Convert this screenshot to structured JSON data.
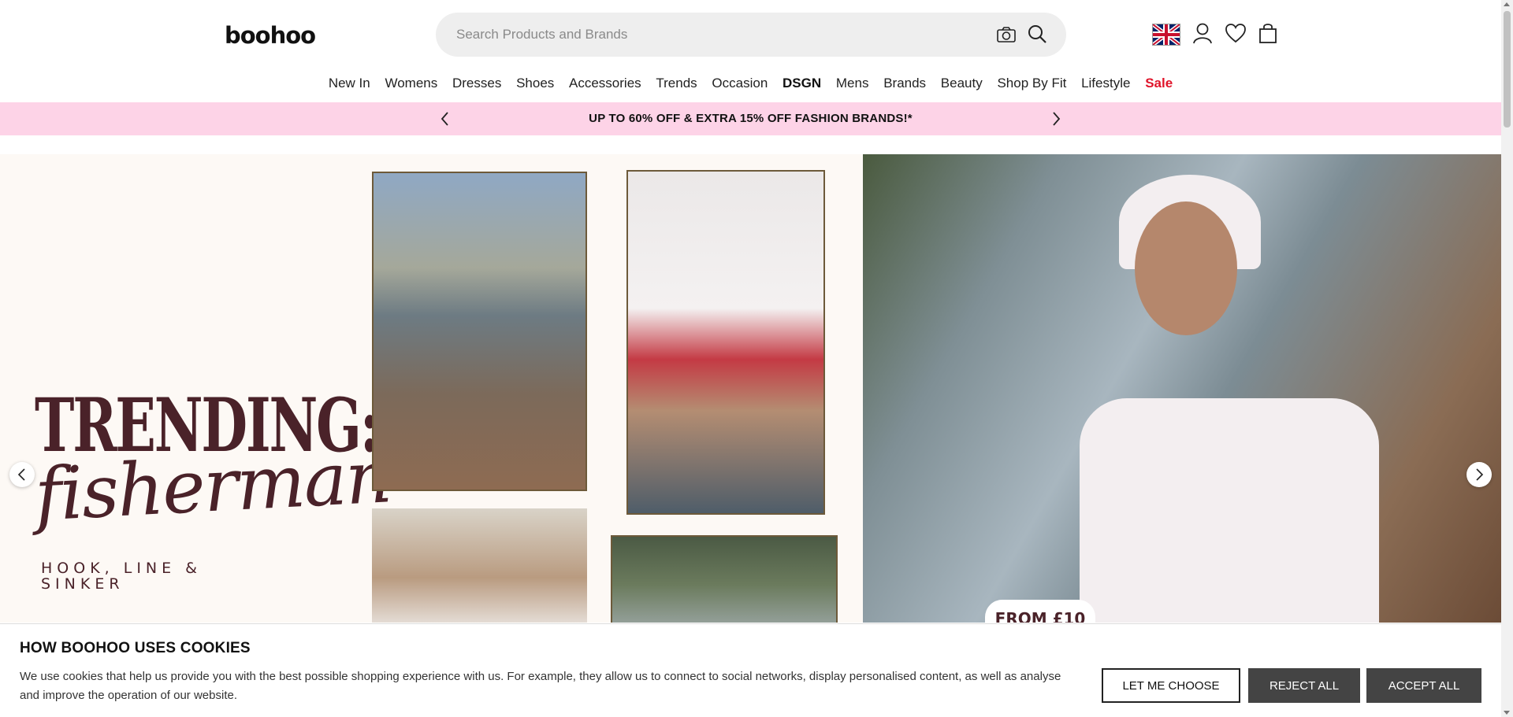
{
  "header": {
    "logo": "boohoo",
    "search_placeholder": "Search Products and Brands",
    "icons": [
      "camera-icon",
      "search-icon",
      "uk-flag-icon",
      "account-icon",
      "wishlist-heart-icon",
      "bag-icon"
    ]
  },
  "nav": {
    "items": [
      "New In",
      "Womens",
      "Dresses",
      "Shoes",
      "Accessories",
      "Trends",
      "Occasion",
      "DSGN",
      "Mens",
      "Brands",
      "Beauty",
      "Shop By Fit",
      "Lifestyle",
      "Sale"
    ]
  },
  "promo": {
    "text": "UP TO 60% OFF & EXTRA 15% OFF FASHION BRANDS!*",
    "bg_color": "#fdd3e7"
  },
  "hero": {
    "title": "TRENDING:",
    "script": "fisherman",
    "subtitle": "HOOK, LINE & SINKER",
    "price_badge": "FROM £10",
    "text_color": "#4a2229"
  },
  "cookie": {
    "title": "HOW BOOHOO USES COOKIES",
    "body": "We use cookies that help us provide you with the best possible shopping experience with us. For example, they allow us to connect to social networks, display personalised content, as well as analyse and improve the operation of our website.",
    "buttons": {
      "choose": "LET ME CHOOSE",
      "reject": "REJECT ALL",
      "accept": "ACCEPT ALL"
    }
  }
}
